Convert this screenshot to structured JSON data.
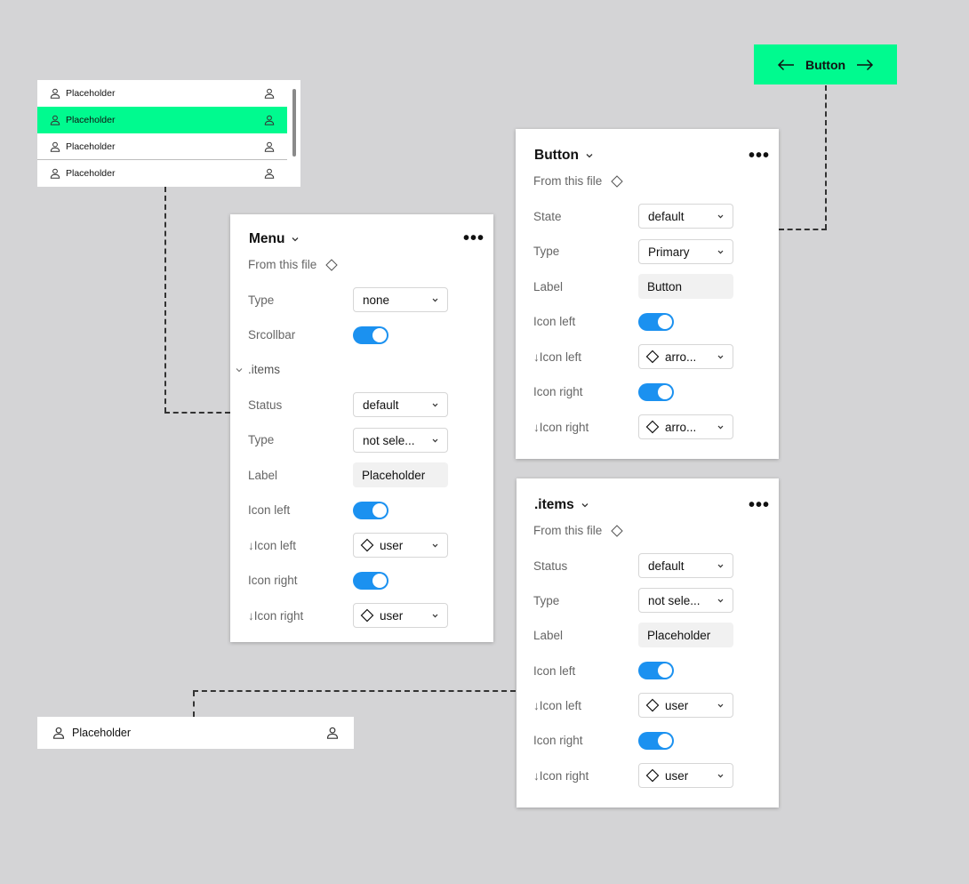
{
  "colors": {
    "canvas": "#d4d4d6",
    "accent_green": "#00fa8f",
    "toggle_blue": "#1b91f0"
  },
  "menu_preview": {
    "items": [
      {
        "label": "Placeholder",
        "selected": false
      },
      {
        "label": "Placeholder",
        "selected": true
      },
      {
        "label": "Placeholder",
        "selected": false
      },
      {
        "label": "Placeholder",
        "selected": false
      }
    ],
    "left_icon": "user-icon",
    "right_icon": "user-icon"
  },
  "button_preview": {
    "label": "Button",
    "left_icon": "arrow-left-icon",
    "right_icon": "arrow-right-icon"
  },
  "item_preview": {
    "label": "Placeholder",
    "left_icon": "user-icon",
    "right_icon": "user-icon"
  },
  "menu_panel": {
    "title": "Menu",
    "source": "From this file",
    "type_label": "Type",
    "type_value": "none",
    "scrollbar_label": "Srcollbar",
    "scrollbar_on": true,
    "group_label": ".items",
    "status_label": "Status",
    "status_value": "default",
    "item_type_label": "Type",
    "item_type_value": "not sele...",
    "label_label": "Label",
    "label_value": "Placeholder",
    "icon_left_label": "Icon left",
    "icon_left_on": true,
    "swap_left_label": "↓Icon left",
    "swap_left_value": "user",
    "icon_right_label": "Icon right",
    "icon_right_on": true,
    "swap_right_label": "↓Icon right",
    "swap_right_value": "user"
  },
  "button_panel": {
    "title": "Button",
    "source": "From this file",
    "state_label": "State",
    "state_value": "default",
    "type_label": "Type",
    "type_value": "Primary",
    "label_label": "Label",
    "label_value": "Button",
    "icon_left_label": "Icon left",
    "icon_left_on": true,
    "swap_left_label": "↓Icon left",
    "swap_left_value": "arro...",
    "icon_right_label": "Icon right",
    "icon_right_on": true,
    "swap_right_label": "↓Icon right",
    "swap_right_value": "arro..."
  },
  "items_panel": {
    "title": ".items",
    "source": "From this file",
    "status_label": "Status",
    "status_value": "default",
    "type_label": "Type",
    "type_value": "not sele...",
    "label_label": "Label",
    "label_value": "Placeholder",
    "icon_left_label": "Icon left",
    "icon_left_on": true,
    "swap_left_label": "↓Icon left",
    "swap_left_value": "user",
    "icon_right_label": "Icon right",
    "icon_right_on": true,
    "swap_right_label": "↓Icon right",
    "swap_right_value": "user"
  }
}
